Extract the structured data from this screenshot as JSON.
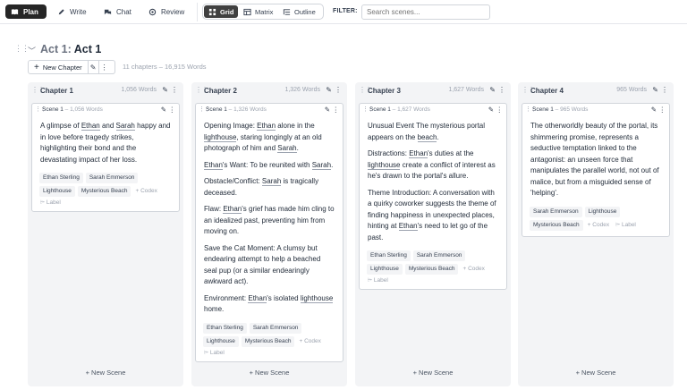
{
  "topbar": {
    "tabs": [
      {
        "label": "Plan",
        "icon": "book-icon",
        "active": true
      },
      {
        "label": "Write",
        "icon": "pen-icon"
      },
      {
        "label": "Chat",
        "icon": "chat-icon"
      },
      {
        "label": "Review",
        "icon": "eye-icon"
      }
    ],
    "views": [
      {
        "label": "Grid",
        "icon": "grid-icon",
        "active": true
      },
      {
        "label": "Matrix",
        "icon": "table-icon"
      },
      {
        "label": "Outline",
        "icon": "outline-icon"
      }
    ],
    "filter_label": "FILTER:",
    "search_placeholder": "Search scenes..."
  },
  "act": {
    "prefix": "Act 1:",
    "name": "Act 1",
    "new_chapter": "New Chapter",
    "meta": "11 chapters – 16,915 Words"
  },
  "chapters": [
    {
      "title": "Chapter 1",
      "words": "1,056 Words",
      "scene_label": "Scene 1",
      "scene_words": "– 1,056 Words",
      "tags": [
        "Ethan Sterling",
        "Sarah Emmerson",
        "Lighthouse",
        "Mysterious Beach"
      ],
      "codex": "+ Codex",
      "label": "Label",
      "new_scene": "+ New Scene"
    },
    {
      "title": "Chapter 2",
      "words": "1,326 Words",
      "scene_label": "Scene 1",
      "scene_words": "– 1,326 Words",
      "tags": [
        "Ethan Sterling",
        "Sarah Emmerson",
        "Lighthouse",
        "Mysterious Beach"
      ],
      "codex": "+ Codex",
      "label": "Label",
      "new_scene": "+ New Scene"
    },
    {
      "title": "Chapter 3",
      "words": "1,627 Words",
      "scene_label": "Scene 1",
      "scene_words": "– 1,627 Words",
      "tags": [
        "Ethan Sterling",
        "Sarah Emmerson",
        "Lighthouse",
        "Mysterious Beach"
      ],
      "codex": "+ Codex",
      "label": "Label",
      "new_scene": "+ New Scene"
    },
    {
      "title": "Chapter 4",
      "words": "965 Words",
      "scene_label": "Scene 1",
      "scene_words": "– 965 Words",
      "tags": [
        "Sarah Emmerson",
        "Lighthouse",
        "Mysterious Beach"
      ],
      "codex": "+ Codex",
      "label": "Label",
      "new_scene": "+ New Scene"
    }
  ],
  "text": {
    "c1p1": [
      "A glimpse of ",
      "Ethan",
      " and ",
      "Sarah",
      " happy and in love before tragedy strikes, highlighting their bond and the devastating impact of her loss."
    ],
    "c2p1": [
      "Opening Image: ",
      "Ethan",
      " alone in the ",
      "lighthouse",
      ", staring longingly at an old photograph of him and ",
      "Sarah",
      "."
    ],
    "c2p2": [
      "Ethan",
      "'s Want: To be reunited with ",
      "Sarah",
      "."
    ],
    "c2p3": [
      "Obstacle/Conflict: ",
      "Sarah",
      " is tragically deceased."
    ],
    "c2p4": [
      "Flaw: ",
      "Ethan",
      "'s grief has made him cling to an idealized past, preventing him from moving on."
    ],
    "c2p5": [
      "Save the Cat Moment: A clumsy but endearing attempt to help a beached seal pup (or a similar endearingly awkward act)."
    ],
    "c2p6": [
      "Environment: ",
      "Ethan",
      "'s isolated ",
      "lighthouse",
      " home."
    ],
    "c3p1": [
      "Unusual Event The mysterious portal appears on the ",
      "beach",
      "."
    ],
    "c3p2": [
      "Distractions: ",
      "Ethan",
      "'s duties at the ",
      "lighthouse",
      " create a conflict of interest as he's drawn to the portal's allure."
    ],
    "c3p3": [
      "Theme Introduction: A conversation with a quirky coworker suggests the theme of finding happiness in unexpected places, hinting at ",
      "Ethan",
      "'s need to let go of the past."
    ],
    "c4p1": [
      "The otherworldly beauty of the portal, its shimmering promise, represents a seductive temptation linked to the antagonist: an unseen force that manipulates the parallel world, not out of malice, but from a misguided sense of 'helping'."
    ]
  }
}
